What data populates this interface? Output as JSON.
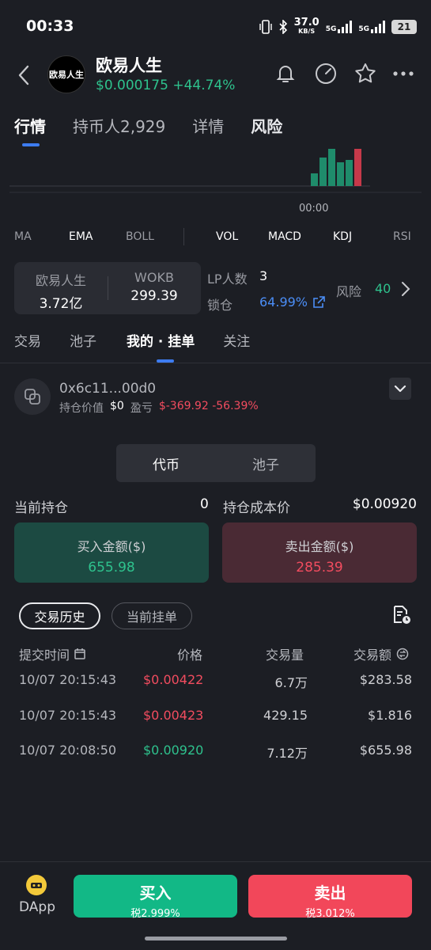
{
  "status_bar": {
    "time": "00:33",
    "net_speed": "37.0",
    "net_unit": "KB/S",
    "sig1": "5G",
    "sig2": "5G",
    "battery": "21"
  },
  "header": {
    "token_name": "欧易人生",
    "avatar_text": "欧易人生",
    "price": "$0.000175",
    "change": "+44.74%"
  },
  "main_tabs": [
    "行情",
    "持币人2,929",
    "详情",
    "风险"
  ],
  "chart": {
    "time_label": "00:00",
    "bar_colors": [
      "#1f8c6b",
      "#1f8c6b",
      "#1f8c6b",
      "#1f8c6b",
      "#1f8c6b",
      "#c6394a"
    ]
  },
  "indicators": {
    "ma": "MA",
    "ema": "EMA",
    "boll": "BOLL",
    "vol": "VOL",
    "macd": "MACD",
    "kdj": "KDJ",
    "rsi": "RSI"
  },
  "stats": {
    "col1_label": "欧易人生",
    "col1_value": "3.72亿",
    "col2_label": "WOKB",
    "col2_value": "299.39",
    "lp_label": "LP人数",
    "lp_value": "3",
    "lock_label": "锁仓",
    "lock_value": "64.99%",
    "risk_label": "风险",
    "risk_value": "40"
  },
  "sub_tabs": [
    "交易",
    "池子",
    "我的 · 挂单",
    "关注"
  ],
  "wallet": {
    "address": "0x6c11...00d0",
    "holding_label": "持仓价值",
    "holding_value": "$0",
    "pnl_label": "盈亏",
    "pnl_value": "$-369.92 -56.39%"
  },
  "segment": [
    "代币",
    "池子"
  ],
  "holdings": {
    "position_label": "当前持仓",
    "position_value": "0",
    "cost_label": "持仓成本价",
    "cost_value": "$0.00920",
    "buy_label": "买入金额($)",
    "buy_value": "655.98",
    "sell_label": "卖出金额($)",
    "sell_value": "285.39"
  },
  "history": {
    "tab_active": "交易历史",
    "tab_inactive": "当前挂单",
    "columns": [
      "提交时间",
      "价格",
      "交易量",
      "交易额"
    ],
    "rows": [
      {
        "time": "10/07 20:15:43",
        "price": "$0.00422",
        "side": "sell",
        "qty": "6.7万",
        "amount": "$283.58"
      },
      {
        "time": "10/07 20:15:43",
        "price": "$0.00423",
        "side": "sell",
        "qty": "429.15",
        "amount": "$1.816"
      },
      {
        "time": "10/07 20:08:50",
        "price": "$0.00920",
        "side": "buy",
        "qty": "7.12万",
        "amount": "$655.98"
      }
    ]
  },
  "bottom": {
    "dapp_label": "DApp",
    "buy_label": "买入",
    "buy_tax": "税2.999%",
    "sell_label": "卖出",
    "sell_tax": "税3.012%"
  },
  "colors": {
    "green": "#2ec28d",
    "red": "#f24c5f",
    "accent": "#3d7cf0",
    "bg": "#1c1e24"
  }
}
